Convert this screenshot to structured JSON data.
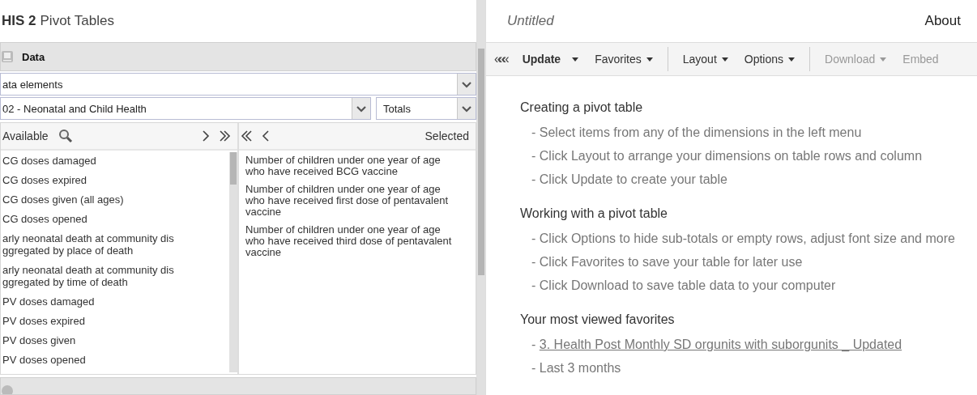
{
  "app_title": {
    "bold": "HIS 2",
    "rest": "Pivot Tables"
  },
  "data_panel": {
    "title": "Data",
    "type_select": "ata elements",
    "group_select": "02 - Neonatal and Child Health",
    "detail_select": "Totals",
    "available_label": "Available",
    "selected_label": "Selected",
    "available": [
      "CG doses damaged",
      "CG doses expired",
      "CG doses given (all ages)",
      "CG doses opened",
      "arly neonatal death at community dis\nggregated by place of death",
      "arly neonatal death  at community dis\nggregated by time of death",
      "PV doses damaged",
      "PV doses expired",
      "PV doses given",
      "PV doses opened"
    ],
    "selected": [
      "Number of children under one year of age who have received BCG vaccine",
      "Number of children under one year of age who have received first dose of pentavalent vaccine",
      "Number of children under one year of age who have received third dose of pentavalent vaccine"
    ]
  },
  "report_title": "Untitled",
  "about": "About",
  "toolbar": [
    {
      "kind": "collapse",
      "label": "«««"
    },
    {
      "kind": "primary",
      "label": "Update",
      "disabled": false
    },
    {
      "kind": "menu",
      "label": "Favorites",
      "disabled": false
    },
    {
      "kind": "separator"
    },
    {
      "kind": "menu",
      "label": "Layout",
      "disabled": false
    },
    {
      "kind": "menu",
      "label": "Options",
      "disabled": false
    },
    {
      "kind": "separator"
    },
    {
      "kind": "menu",
      "label": "Download",
      "disabled": true
    },
    {
      "kind": "plain",
      "label": "Embed",
      "disabled": true
    }
  ],
  "sections": [
    {
      "title": "Creating a pivot table",
      "items": [
        {
          "text": "- Select items from any of the dimensions in the left menu"
        },
        {
          "text": "- Click Layout to arrange your dimensions on table rows and column"
        },
        {
          "text": "- Click Update to create your table"
        }
      ]
    },
    {
      "title": "Working with a pivot table",
      "items": [
        {
          "text": "- Click Options to hide sub-totals or empty rows, adjust font size and more"
        },
        {
          "text": "- Click Favorites to save your table for later use"
        },
        {
          "text": "- Click Download to save table data to your computer"
        }
      ]
    },
    {
      "title": "Your most viewed favorites",
      "items": [
        {
          "prefix": "- ",
          "link": "3. Health Post Monthly SD orgunits with suborgunits _ Updated"
        },
        {
          "text": "- Last 3 months"
        }
      ]
    }
  ]
}
